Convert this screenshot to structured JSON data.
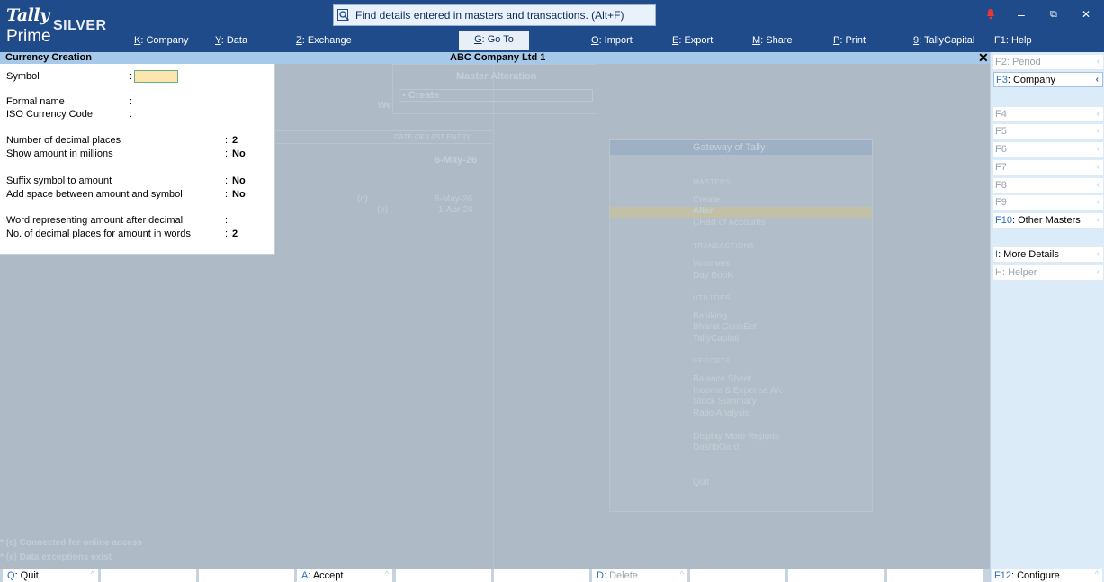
{
  "app": {
    "logo_tally": "Tally",
    "logo_prime": "Prime",
    "edition": "SILVER"
  },
  "search": {
    "text": "Find details entered in masters and transactions. (Alt+F)"
  },
  "topmenu": [
    {
      "key": "K",
      "label": ": Company"
    },
    {
      "key": "Y",
      "label": ": Data"
    },
    {
      "key": "Z",
      "label": ": Exchange"
    },
    {
      "key": "G",
      "label": ": Go To"
    },
    {
      "key": "O",
      "label": ": Import"
    },
    {
      "key": "E",
      "label": ": Export"
    },
    {
      "key": "M",
      "label": ": Share"
    },
    {
      "key": "P",
      "label": ": Print"
    },
    {
      "key": "9",
      "label": ": TallyCapital"
    },
    {
      "key": "F1",
      "label": ": Help"
    }
  ],
  "window_controls": {
    "minimize": "–",
    "restore": "⧉",
    "close": "✕"
  },
  "titlebar": {
    "screen": "Currency Creation",
    "company": "ABC Company Ltd 1",
    "close": "✕"
  },
  "form": {
    "symbol_label": "Symbol",
    "formal_name_label": "Formal name",
    "iso_code_label": "ISO Currency Code",
    "decimal_places_label": "Number of decimal places",
    "decimal_places_value": "2",
    "millions_label": "Show amount in millions",
    "millions_value": "No",
    "suffix_label": "Suffix symbol to amount",
    "suffix_value": "No",
    "space_label": "Add space between amount and symbol",
    "space_value": "No",
    "word_label": "Word representing amount after decimal",
    "words_places_label": "No. of decimal places for amount in words",
    "words_places_value": "2",
    "colon": ":"
  },
  "background": {
    "master_alteration": "Master Alteration",
    "create_item": "• Create",
    "we": "We",
    "date_of_last_entry": "DATE OF LAST ENTRY",
    "date1": "6-May-26",
    "c_mark": "(c)",
    "e_mark": "(e)",
    "date2": "6-May-26",
    "date3": "1-Apr-26",
    "gateway_title": "Gateway of Tally",
    "masters_section": "MASTERS",
    "create": "Create",
    "alter": "Alter",
    "chart": "CHart of Accounts",
    "transactions_section": "TRANSACTIONS",
    "vouchers": "Vouchers",
    "daybook": "Day BooK",
    "utilities_section": "UTILITIES",
    "banking": "BaNking",
    "bharat": "Bharat ConnEct",
    "tallycapital": "TallyCapital",
    "reports_section": "REPORTS",
    "balance_sheet": "Balance Sheet",
    "income": "Income & Expense A/c",
    "stock": "Stock Summary",
    "ratio": "Ratio Analysis",
    "more_reports": "Display More Reports",
    "dashboard": "DashbOard",
    "quit": "Quit",
    "note_c": "* (c) Connected for online access",
    "note_e": "* (e) Data exceptions exist"
  },
  "sidebar": [
    {
      "key": "F2",
      "label": ": Period",
      "state": "disabled"
    },
    {
      "key": "F3",
      "label": ": Company",
      "state": "selected"
    },
    {
      "key": "F4",
      "label": "",
      "state": "disabled"
    },
    {
      "key": "F5",
      "label": "",
      "state": "disabled"
    },
    {
      "key": "F6",
      "label": "",
      "state": "disabled"
    },
    {
      "key": "F7",
      "label": "",
      "state": "disabled"
    },
    {
      "key": "F8",
      "label": "",
      "state": "disabled"
    },
    {
      "key": "F9",
      "label": "",
      "state": "disabled"
    },
    {
      "key": "F10",
      "label": ": Other Masters",
      "state": "enabled"
    },
    {
      "key": "I",
      "label": ": More Details",
      "state": "enabled"
    },
    {
      "key": "H",
      "label": ": Helper",
      "state": "disabled"
    }
  ],
  "bottombar": [
    {
      "key": "Q",
      "label": ": Quit",
      "state": "enabled"
    },
    {
      "key": "A",
      "label": ": Accept",
      "state": "enabled"
    },
    {
      "key": "D",
      "label": ": Delete",
      "state": "disabled"
    }
  ],
  "configure": {
    "key": "F12",
    "label": ": Configure"
  },
  "colors": {
    "topbar": "#1f4b8a",
    "title_strip": "#a6c9ea",
    "sidebar": "#dcebf8",
    "key_accent": "#2a6fc4",
    "input_fill": "#fde5b0"
  }
}
